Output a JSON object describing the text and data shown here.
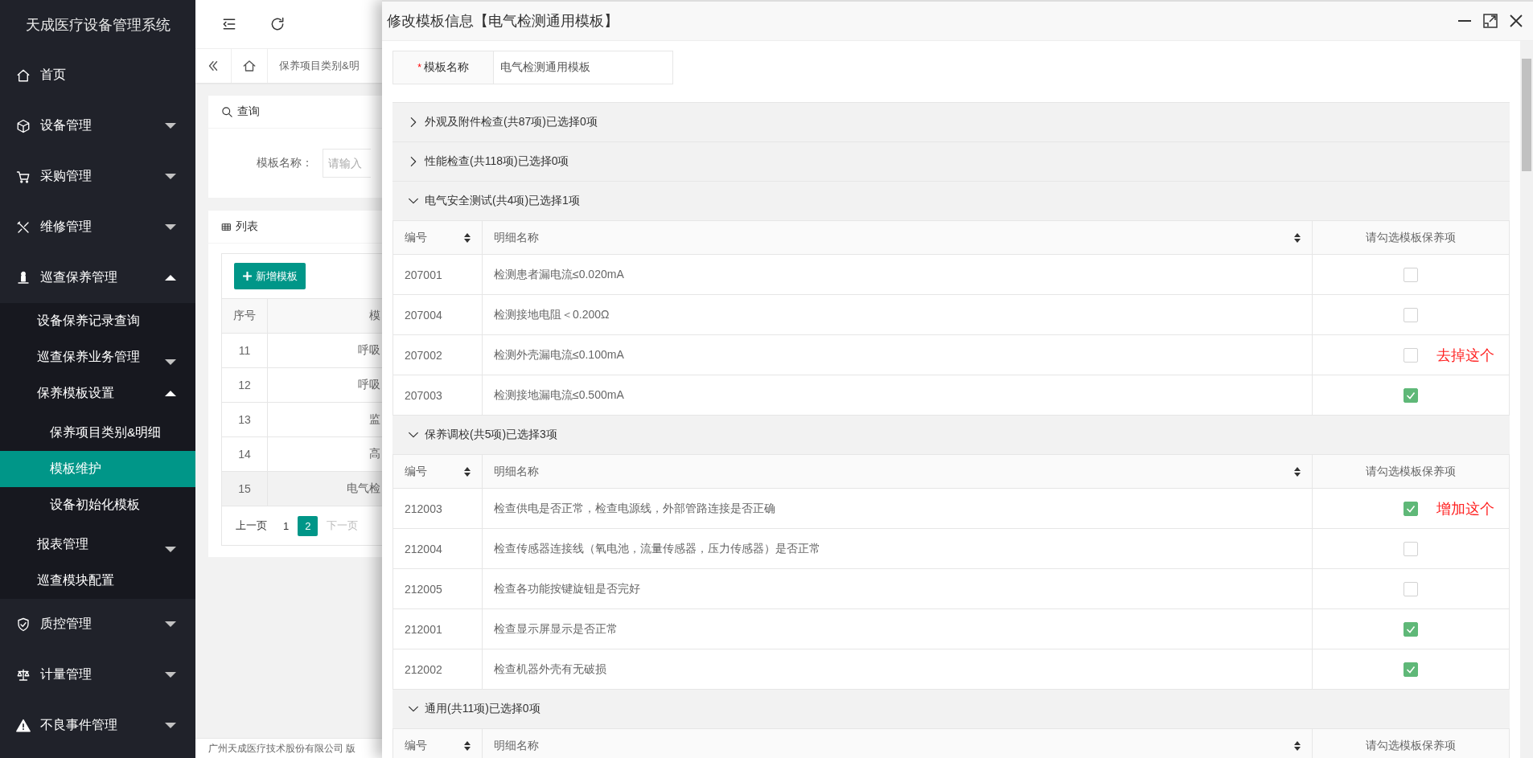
{
  "sidebar": {
    "title": "天成医疗设备管理系统",
    "items": [
      {
        "label": "首页",
        "selected": false
      },
      {
        "label": "设备管理",
        "selected": false,
        "expanded": false
      },
      {
        "label": "采购管理",
        "selected": false,
        "expanded": false
      },
      {
        "label": "维修管理",
        "selected": false,
        "expanded": false
      },
      {
        "label": "巡查保养管理",
        "selected": false,
        "expanded": true,
        "children": [
          {
            "label": "设备保养记录查询",
            "selected": false
          },
          {
            "label": "巡查保养业务管理",
            "selected": false,
            "expanded": false
          },
          {
            "label": "保养模板设置",
            "selected": false,
            "expanded": true,
            "children": [
              {
                "label": "保养项目类别&明细",
                "selected": false
              },
              {
                "label": "模板维护",
                "selected": true
              },
              {
                "label": "设备初始化模板",
                "selected": false
              }
            ]
          },
          {
            "label": "报表管理",
            "selected": false,
            "expanded": false
          },
          {
            "label": "巡查模块配置",
            "selected": false
          }
        ]
      },
      {
        "label": "质控管理",
        "selected": false,
        "expanded": false
      },
      {
        "label": "计量管理",
        "selected": false,
        "expanded": false
      },
      {
        "label": "不良事件管理",
        "selected": false,
        "expanded": false
      }
    ]
  },
  "breadcrumb": {
    "tab": "保养项目类别&明"
  },
  "query_panel": {
    "title": "查询",
    "field_label": "模板名称：",
    "placeholder": "请输入"
  },
  "list_panel": {
    "title": "列表",
    "add_button": "新增模板",
    "columns": [
      "序号",
      "模"
    ],
    "rows": [
      {
        "index": "11",
        "name": "呼吸",
        "selected": false
      },
      {
        "index": "12",
        "name": "呼吸",
        "selected": false
      },
      {
        "index": "13",
        "name": "监",
        "selected": false
      },
      {
        "index": "14",
        "name": "高",
        "selected": false
      },
      {
        "index": "15",
        "name": "电气检",
        "selected": true
      }
    ],
    "pagination": {
      "prev": "上一页",
      "pages": [
        {
          "label": "1",
          "selected": false
        },
        {
          "label": "2",
          "selected": true
        }
      ],
      "next": {
        "label": "下一页",
        "disabled": true
      }
    }
  },
  "footer": "广州天成医疗技术股份有限公司 版",
  "dialog": {
    "title": "修改模板信息【电气检测通用模板】",
    "name_field": {
      "required_mark": "*",
      "label": "模板名称",
      "value": "电气检测通用模板"
    },
    "groups": [
      {
        "title": "外观及附件检查(共87项)已选择0项",
        "expanded": false
      },
      {
        "title": "性能检查(共118项)已选择0项",
        "expanded": false
      },
      {
        "title": "电气安全测试(共4项)已选择1项",
        "expanded": true,
        "columns": [
          "编号",
          "明细名称",
          "请勾选模板保养项"
        ],
        "rows": [
          {
            "code": "207001",
            "name": "检测患者漏电流≤0.020mA",
            "checked": false
          },
          {
            "code": "207004",
            "name": "检测接地电阻＜0.200Ω",
            "checked": false
          },
          {
            "code": "207002",
            "name": "检测外壳漏电流≤0.100mA",
            "checked": false,
            "note": "去掉这个"
          },
          {
            "code": "207003",
            "name": "检测接地漏电流≤0.500mA",
            "checked": true
          }
        ]
      },
      {
        "title": "保养调校(共5项)已选择3项",
        "expanded": true,
        "columns": [
          "编号",
          "明细名称",
          "请勾选模板保养项"
        ],
        "rows": [
          {
            "code": "212003",
            "name": "检查供电是否正常，检查电源线，外部管路连接是否正确",
            "checked": true,
            "note": "增加这个"
          },
          {
            "code": "212004",
            "name": "检查传感器连接线（氧电池，流量传感器，压力传感器）是否正常",
            "checked": false
          },
          {
            "code": "212005",
            "name": "检查各功能按键旋钮是否完好",
            "checked": false
          },
          {
            "code": "212001",
            "name": "检查显示屏显示是否正常",
            "checked": true
          },
          {
            "code": "212002",
            "name": "检查机器外壳有无破损",
            "checked": true
          }
        ]
      },
      {
        "title": "通用(共11项)已选择0项",
        "expanded": true,
        "columns": [
          "编号",
          "明细名称",
          "请勾选模板保养项"
        ]
      }
    ]
  }
}
